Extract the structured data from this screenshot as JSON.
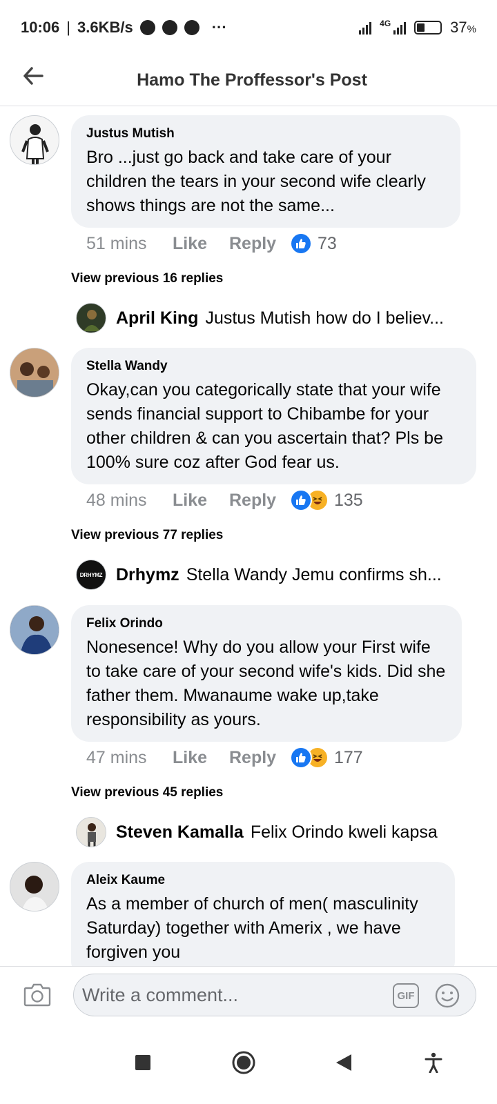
{
  "status_bar": {
    "time": "10:06",
    "speed": "3.6KB/s",
    "dots": "···",
    "network": "4G",
    "battery": "37",
    "battery_unit": "%"
  },
  "header": {
    "title": "Hamo The Proffessor's Post",
    "back_icon": "arrow-left-icon"
  },
  "comments": [
    {
      "author": "Justus Mutish",
      "text": "Bro ...just go back and take care of your children the tears in your second wife clearly shows things are not the same...",
      "time": "51 mins",
      "like_label": "Like",
      "reply_label": "Reply",
      "reactions": [
        "like"
      ],
      "reaction_count": "73",
      "view_previous": "View previous 16 replies",
      "latest_reply": {
        "name": "April King",
        "snippet": "Justus Mutish how do I believ..."
      }
    },
    {
      "author": "Stella Wandy",
      "text": "Okay,can you categorically state that your wife sends financial support to Chibambe for your other children & can you ascertain that? Pls be 100% sure coz after God fear us.",
      "time": "48 mins",
      "like_label": "Like",
      "reply_label": "Reply",
      "reactions": [
        "like",
        "haha"
      ],
      "reaction_count": "135",
      "view_previous": "View previous 77 replies",
      "latest_reply": {
        "name": "Drhymz",
        "snippet": "Stella Wandy Jemu confirms sh...",
        "avatar_text": "DRHYMZ"
      }
    },
    {
      "author": "Felix Orindo",
      "text": "Nonesence! Why do you allow your First wife to take care of your second wife's kids. Did she father them. Mwanaume wake up,take responsibility as yours.",
      "time": "47 mins",
      "like_label": "Like",
      "reply_label": "Reply",
      "reactions": [
        "like",
        "haha"
      ],
      "reaction_count": "177",
      "view_previous": "View previous 45 replies",
      "latest_reply": {
        "name": "Steven Kamalla",
        "snippet": "Felix Orindo kweli kapsa"
      }
    },
    {
      "author": "Aleix Kaume",
      "text": "As a member of church of men( masculinity Saturday) together with Amerix , we have forgiven you"
    }
  ],
  "composer": {
    "placeholder": "Write a comment...",
    "gif_label": "GIF"
  },
  "colors": {
    "like_blue": "#1877f2",
    "haha_yellow": "#f7b125",
    "bubble_bg": "#f0f2f5",
    "meta_gray": "#8a8d91"
  }
}
